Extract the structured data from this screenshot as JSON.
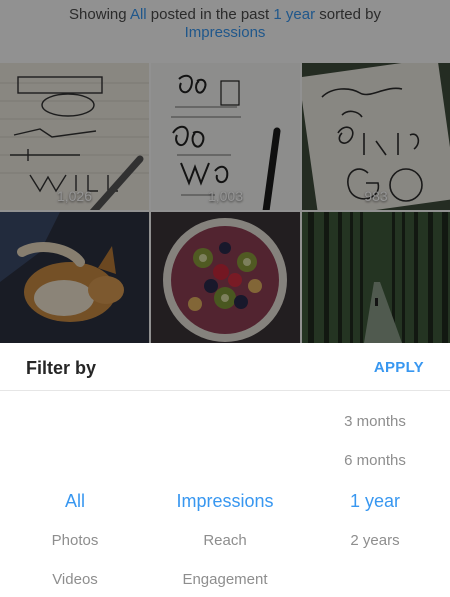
{
  "summary": {
    "prefix": "Showing ",
    "type": "All",
    "middle": " posted in the past ",
    "period": "1 year",
    "suffix": " sorted by",
    "metric": "Impressions"
  },
  "grid": {
    "tiles": [
      {
        "count": "1,026"
      },
      {
        "count": "1,003"
      },
      {
        "count": "983"
      },
      {
        "count": ""
      },
      {
        "count": ""
      },
      {
        "count": ""
      }
    ]
  },
  "filter": {
    "title": "Filter by",
    "apply_label": "APPLY"
  },
  "picker": {
    "types": [
      "All",
      "Photos",
      "Videos"
    ],
    "metrics": [
      "Impressions",
      "Reach",
      "Engagement"
    ],
    "periods": [
      "3 months",
      "6 months",
      "1 year",
      "2 years"
    ]
  },
  "colors": {
    "accent": "#3897f0",
    "muted": "#8e8e8e"
  }
}
